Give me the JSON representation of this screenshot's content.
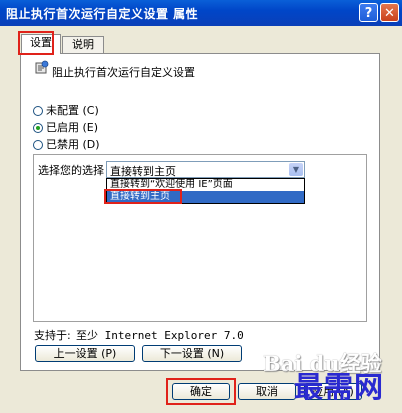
{
  "window": {
    "title": "阻止执行首次运行自定义设置 属性",
    "help_label": "?",
    "close_label": "✕"
  },
  "tabs": [
    {
      "label": "设置",
      "active": true
    },
    {
      "label": "说明",
      "active": false
    }
  ],
  "policy": {
    "icon": "policy-setting-icon",
    "name": "阻止执行首次运行自定义设置"
  },
  "radios": [
    {
      "label": "未配置 (C)",
      "checked": false
    },
    {
      "label": "已启用 (E)",
      "checked": true
    },
    {
      "label": "已禁用 (D)",
      "checked": false
    }
  ],
  "options": {
    "label": "选择您的选择",
    "selected": "直接转到主页",
    "dropdown_items": [
      "直接转到“欢迎使用 IE”页面",
      "直接转到主页"
    ]
  },
  "supported": {
    "label": "支持于:",
    "value": "至少 Internet Explorer 7.0"
  },
  "nav_buttons": {
    "prev": "上一设置 (P)",
    "next": "下一设置 (N)"
  },
  "dialog_buttons": {
    "ok": "确定",
    "cancel": "取消",
    "apply": "应用 (A)"
  },
  "watermarks": {
    "baidu": "Bai du经验",
    "site": "最需网"
  },
  "colors": {
    "title_bar": "#0a5fd8",
    "highlight_box": "#e0221a",
    "selection": "#316ac5"
  }
}
